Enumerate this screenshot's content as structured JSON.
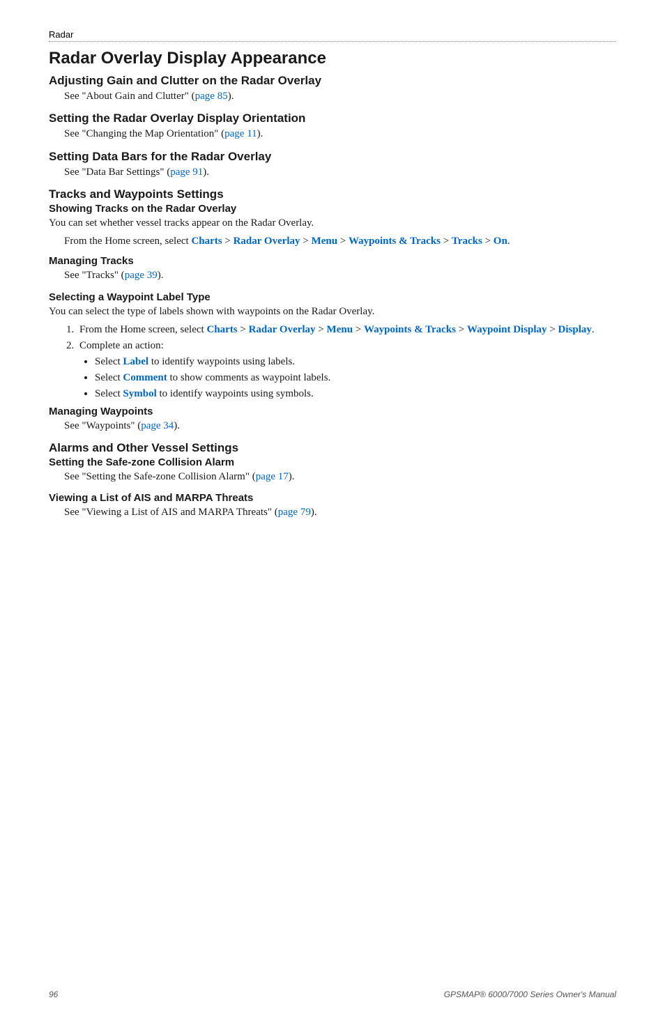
{
  "runningHead": "Radar",
  "title": "Radar Overlay Display Appearance",
  "sections": {
    "gain": {
      "heading": "Adjusting Gain and Clutter on the Radar Overlay",
      "text_a": "See \"About Gain and Clutter\" (",
      "link": "page 85",
      "text_b": ")."
    },
    "orientation": {
      "heading": "Setting the Radar Overlay Display Orientation",
      "text_a": "See \"Changing the Map Orientation\" (",
      "link": "page 11",
      "text_b": ")."
    },
    "databars": {
      "heading": "Setting Data Bars for the Radar Overlay",
      "text_a": "See \"Data Bar Settings\" (",
      "link": "page 91",
      "text_b": ")."
    },
    "tw": {
      "heading": "Tracks and Waypoints Settings",
      "show": {
        "heading": "Showing Tracks on the Radar Overlay",
        "intro": "You can set whether vessel tracks appear on the Radar Overlay.",
        "step_a": "From the Home screen, select ",
        "m1": "Charts",
        "gt1": " > ",
        "m2": "Radar Overlay",
        "gt2": " > ",
        "m3": "Menu",
        "gt3": " > ",
        "m4": "Waypoints & Tracks",
        "gt4": " > ",
        "m5": "Tracks",
        "gt5": " > ",
        "m6": "On",
        "period": "."
      },
      "manageTracks": {
        "heading": "Managing Tracks",
        "text_a": "See \"Tracks\" (",
        "link": "page 39",
        "text_b": ")."
      },
      "wpLabel": {
        "heading": "Selecting a Waypoint Label Type",
        "intro": "You can select the type of labels shown with waypoints on the Radar Overlay.",
        "li1_a": "From the Home screen, select ",
        "li1_m1": "Charts",
        "li1_gt1": " > ",
        "li1_m2": "Radar Overlay",
        "li1_gt2": " > ",
        "li1_m3": "Menu",
        "li1_gt3": " > ",
        "li1_m4": "Waypoints & Tracks",
        "li1_gt4": " > ",
        "li1_m5": "Waypoint Display",
        "li1_gt5": " > ",
        "li1_m6": "Display",
        "li1_period": ".",
        "li2": "Complete an action:",
        "b1_a": "Select ",
        "b1_m": "Label",
        "b1_b": " to identify waypoints using labels.",
        "b2_a": "Select ",
        "b2_m": "Comment",
        "b2_b": " to show comments as waypoint labels.",
        "b3_a": "Select ",
        "b3_m": "Symbol",
        "b3_b": " to identify waypoints using symbols."
      },
      "manageWp": {
        "heading": "Managing Waypoints",
        "text_a": "See \"Waypoints\" (",
        "link": "page 34",
        "text_b": ")."
      }
    },
    "alarms": {
      "heading": "Alarms and Other Vessel Settings",
      "safe": {
        "heading": "Setting the Safe-zone Collision Alarm",
        "text_a": "See \"Setting the Safe-zone Collision Alarm\" (",
        "link": "page 17",
        "text_b": ")."
      },
      "ais": {
        "heading": "Viewing a List of AIS and MARPA Threats",
        "text_a": "See \"Viewing a List of AIS and MARPA Threats\" (",
        "link": "page 79",
        "text_b": ")."
      }
    }
  },
  "footer": {
    "page": "96",
    "manual_a": "GPSMAP",
    "reg": "®",
    "manual_b": " 6000/7000 Series Owner's Manual"
  }
}
